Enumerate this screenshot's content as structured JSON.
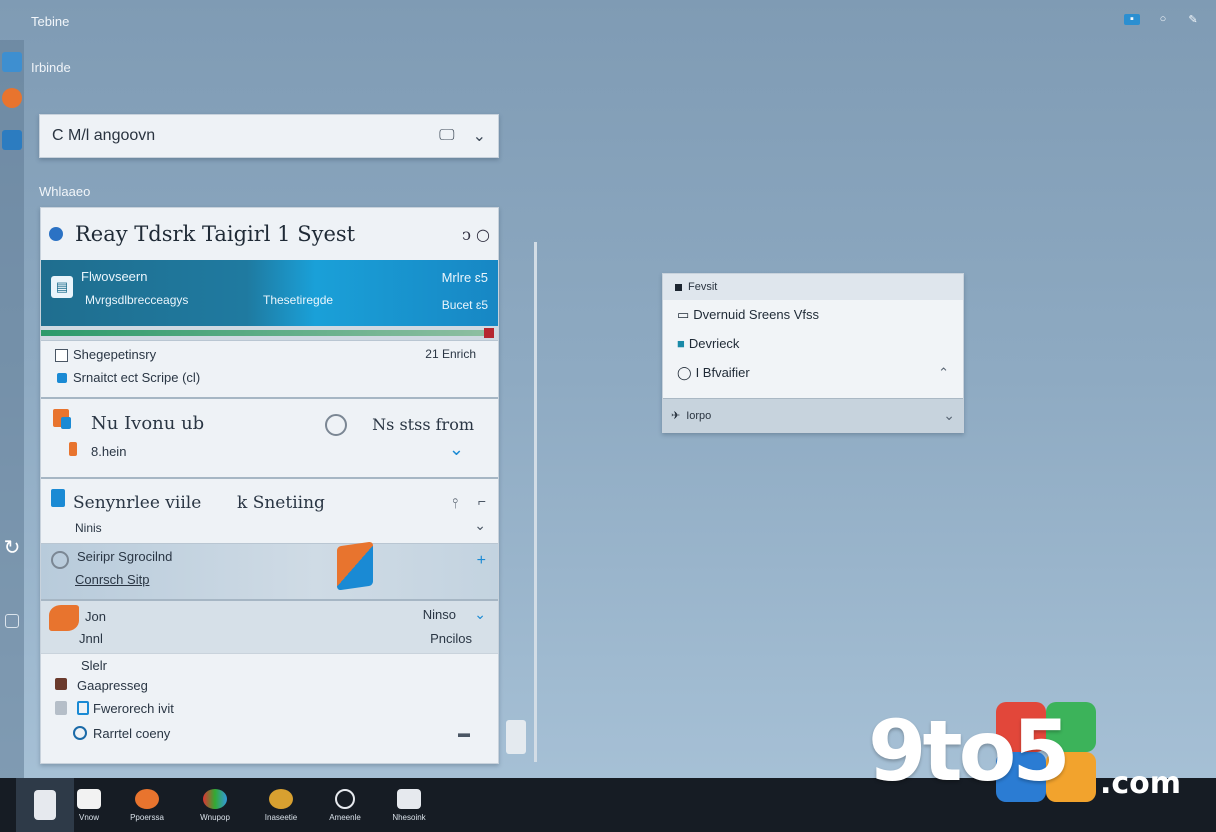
{
  "window": {
    "title": "Tebine"
  },
  "tray": {
    "icons": [
      "network-icon",
      "circle-status-icon",
      "pen-icon"
    ]
  },
  "sidebar": {
    "subtitle": "Irbinde"
  },
  "search": {
    "value": "C M/l angoovn"
  },
  "section": {
    "label": "Whlaaeo"
  },
  "panel": {
    "title": "Reay Tdsrk Taigirl 1 Syest",
    "header_glyph": "ↄ ○",
    "banner": {
      "title": "Flwovseern",
      "sub": "Mvrgsdlbrecceagys",
      "mid": "Thesetiregde",
      "right_top": "Mrlre ɛ5",
      "right_bottom": "Bucet ɛ5"
    },
    "progress": 0.99,
    "rows": {
      "r1_label": "Shegepetinsry",
      "r1_right": "21 Enrich",
      "r1_sub": "Srnaitct ect Scripe (cl)",
      "r2_label": "Nu Ivonu ub",
      "r2_right": "Ns stss from",
      "r2_sub": "8.hein",
      "r3_label": "Senynrlee viile",
      "r3_mid": "k Snetiing",
      "r3_sub": "Ninis",
      "r4_label": "Seiripr Sgrocilnd",
      "r4_sub": "Conrsch Sitp",
      "r5_label": "Jon",
      "r5_right_top": "Ninso",
      "r5_right_bottom": "Pncilos",
      "r5_sub": "Jnnl",
      "list_1": "Slelr",
      "list_2": "Gaapresseg",
      "list_3": "Fwerorech ivit",
      "list_4": "Rarrtel coeny"
    }
  },
  "popup": {
    "header": "Fevsit",
    "items": [
      "Dvernuid Sreens Vfss",
      "Devrieck",
      "I Bfvaifier"
    ],
    "footer": "Iorpo"
  },
  "taskbar": {
    "items": [
      "Vnow",
      "Ppoerssa",
      "Wnupop",
      "Inaseetie",
      "Ameenle",
      "Nhesoink"
    ]
  },
  "watermark": {
    "text": "9to5",
    "suffix": ".com"
  },
  "colors": {
    "accent": "#1a8ad4",
    "banner": "#1f7aa0",
    "taskbar": "#161c24",
    "desktop": "#8eaac2"
  }
}
